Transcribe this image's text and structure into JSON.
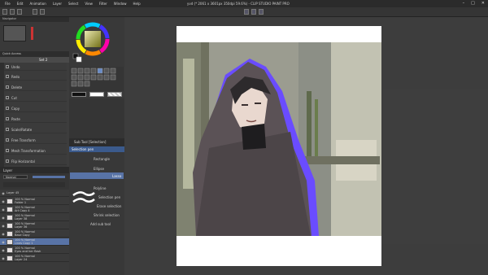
{
  "window": {
    "title": "yvd (* 2061 x 3601px 350dpi 59.6%) - CLIP STUDIO PAINT PRO",
    "menu": [
      "File",
      "Edit",
      "Animation",
      "Layer",
      "Select",
      "View",
      "Filter",
      "Window",
      "Help"
    ]
  },
  "navigator": {
    "tab": "Navigator"
  },
  "subtool_panel": {
    "title": "Quick Access",
    "set_label": "Set 2"
  },
  "history": {
    "items": [
      "Undo",
      "Redo",
      "Delete",
      "Cut",
      "Copy",
      "Paste",
      "Scale/Rotate",
      "Free Transform",
      "Mesh Transformation",
      "Flip Horizontal"
    ]
  },
  "tool_property": {
    "header": "Sub Tool [Selection]",
    "selected": "Selection pen",
    "options": [
      "Rectangle",
      "Ellipse",
      "Lasso",
      "Polyline",
      "Selection pen",
      "Erase selection",
      "Shrink selection"
    ],
    "add_label": "Add sub tool"
  },
  "layers": {
    "title": "Layer",
    "blend": "Normal",
    "rows": [
      {
        "name": "Layer 45",
        "mode": ""
      },
      {
        "name": "100 % Normal",
        "mode": "Folder 1"
      },
      {
        "name": "100 % Normal",
        "mode": "Art Copy 4"
      },
      {
        "name": "100 % Normal",
        "mode": "Layer 38"
      },
      {
        "name": "100 % Normal",
        "mode": "Layer 36"
      },
      {
        "name": "100 % Normal",
        "mode": "Base Copy"
      },
      {
        "name": "100 % Normal",
        "mode": "Lines Copy 1"
      },
      {
        "name": "100 % Normal",
        "mode": "Eyes and her flash"
      },
      {
        "name": "100 % Normal",
        "mode": "Layer 24"
      }
    ],
    "selected_index": 6
  },
  "colors": {
    "accent": "#5873a6",
    "purple_glow": "#6a4cff"
  }
}
